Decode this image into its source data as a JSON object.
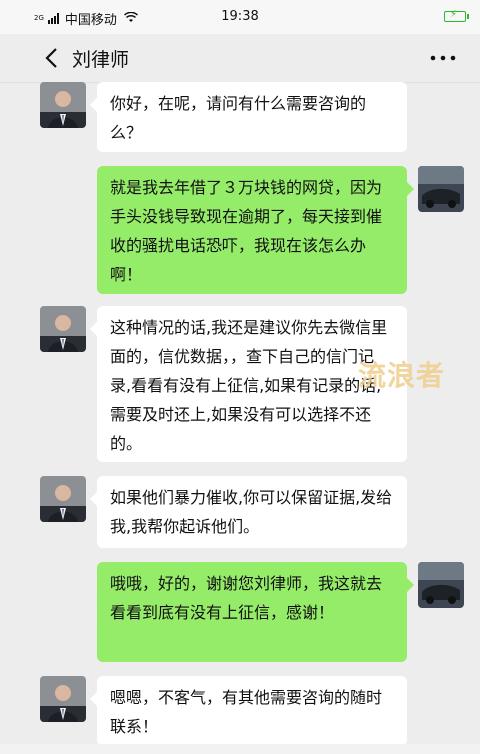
{
  "status_bar": {
    "carrier_prefix": "2G",
    "carrier": "中国移动",
    "time": "19:38",
    "wifi_icon": "wifi-icon",
    "battery_icon": "battery-charging-icon"
  },
  "nav": {
    "title": "刘律师",
    "back_icon": "chevron-left-icon",
    "more_icon": "more-dots-icon"
  },
  "messages": [
    {
      "side": "incoming",
      "text": "你好，在呢，请问有什么需要咨询的么？"
    },
    {
      "side": "outgoing",
      "text": "就是我去年借了３万块钱的网贷，因为手头没钱导致现在逾期了，每天接到催收的骚扰电话恐吓，我现在该怎么办啊！"
    },
    {
      "side": "incoming",
      "text": "这种情况的话,我还是建议你先去微信里面的，信优数据，，查下自己的信门记录,看看有没有上征信,如果有记录的话,需要及时还上,如果没有可以选择不还的。"
    },
    {
      "side": "incoming",
      "text": "如果他们暴力催收,你可以保留证据,发给我,我帮你起诉他们。"
    },
    {
      "side": "outgoing",
      "text": "哦哦，好的，谢谢您刘律师，我这就去看看到底有没有上征信，感谢！"
    },
    {
      "side": "incoming",
      "text": "嗯嗯，不客气，有其他需要咨询的随时联系！"
    }
  ],
  "watermark": "流浪者",
  "colors": {
    "outgoing_bubble": "#95ec69",
    "incoming_bubble": "#ffffff",
    "background": "#ededed"
  }
}
